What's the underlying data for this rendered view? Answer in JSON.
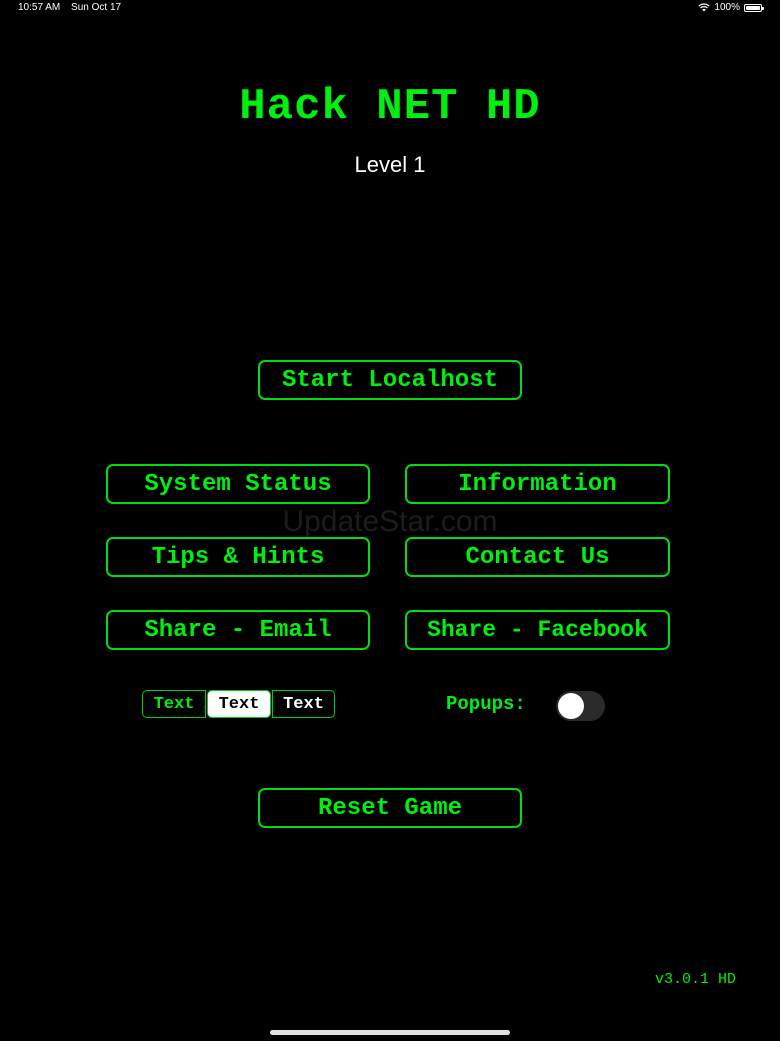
{
  "status_bar": {
    "time": "10:57 AM",
    "date": "Sun Oct 17",
    "battery": "100%"
  },
  "app": {
    "title": "Hack NET HD",
    "level": "Level 1",
    "watermark": "UpdateStar.com",
    "accent_color": "#00ee10"
  },
  "buttons": {
    "start": "Start Localhost",
    "system_status": "System Status",
    "information": "Information",
    "tips": "Tips & Hints",
    "contact": "Contact Us",
    "share_email": "Share - Email",
    "share_facebook": "Share - Facebook",
    "reset": "Reset Game"
  },
  "segmented": {
    "options": [
      "Text",
      "Text",
      "Text"
    ],
    "selected_index": 1
  },
  "popups": {
    "label": "Popups:",
    "enabled": false
  },
  "version": "v3.0.1 HD"
}
